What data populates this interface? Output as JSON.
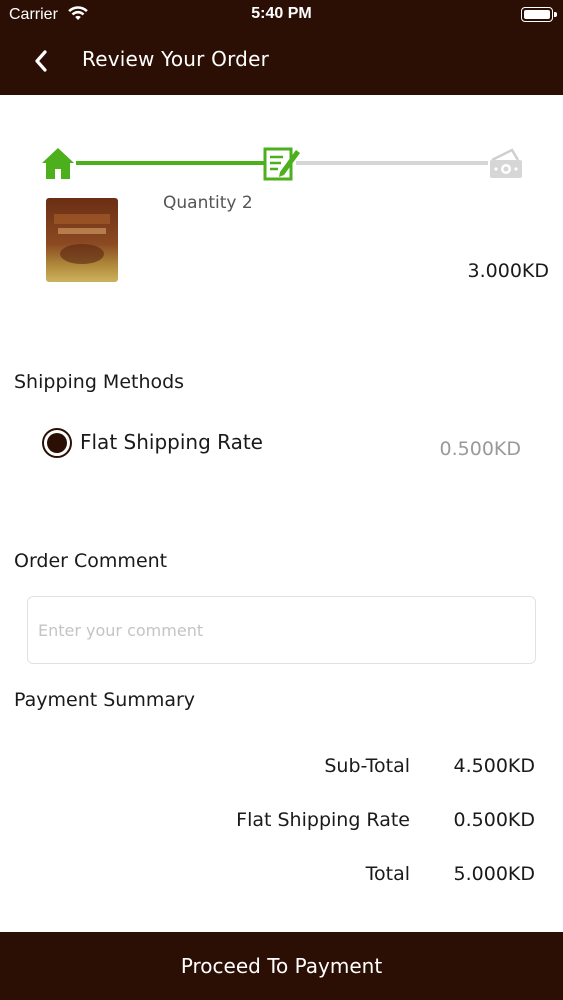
{
  "status_bar": {
    "carrier": "Carrier",
    "time": "5:40 PM"
  },
  "nav": {
    "title": "Review Your Order"
  },
  "stepper": {
    "icons": [
      "home-icon",
      "edit-document-icon",
      "cash-payment-icon"
    ],
    "active_color": "#4caf1c",
    "inactive_color": "#d6d6d6"
  },
  "product": {
    "quantity_text": "Quantity  2",
    "price": "3.000KD"
  },
  "shipping": {
    "title": "Shipping Methods",
    "method_label": "Flat Shipping Rate",
    "method_price": "0.500KD"
  },
  "comment": {
    "title": "Order Comment",
    "placeholder": "Enter your comment"
  },
  "summary": {
    "title": "Payment Summary",
    "rows": [
      {
        "label": "Sub-Total",
        "value": "4.500KD"
      },
      {
        "label": "Flat Shipping Rate",
        "value": "0.500KD"
      },
      {
        "label": "Total",
        "value": "5.000KD"
      }
    ]
  },
  "footer": {
    "button_label": "Proceed To Payment"
  },
  "colors": {
    "brand": "#2b0f05",
    "accent": "#4caf1c"
  }
}
